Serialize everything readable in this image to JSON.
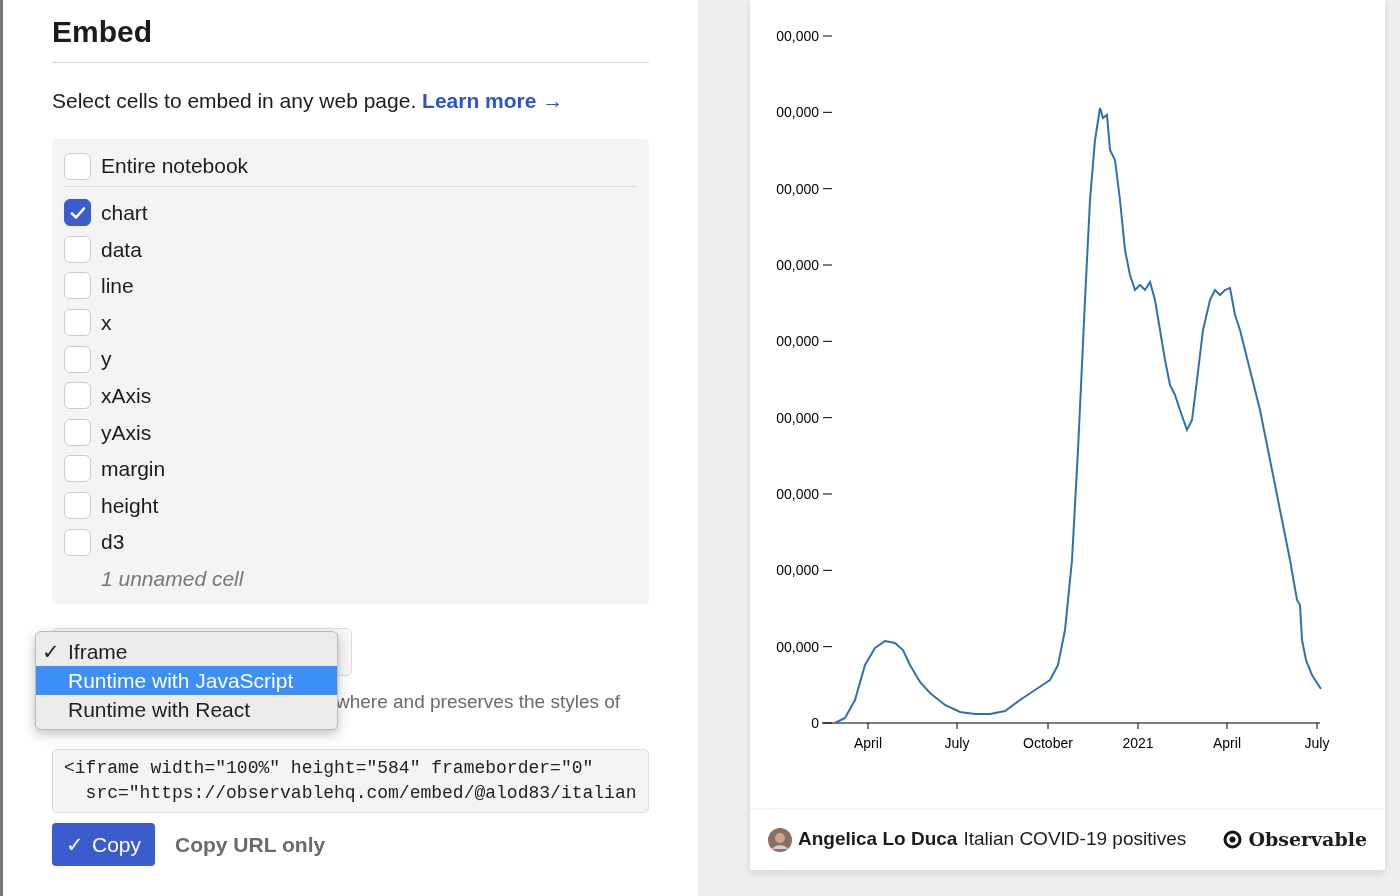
{
  "dialog": {
    "title": "Embed",
    "intro": "Select cells to embed in any web page.",
    "learn_more": "Learn more →",
    "cells": [
      {
        "label": "Entire notebook",
        "checked": false,
        "kind": "all"
      },
      {
        "label": "chart",
        "checked": true,
        "kind": "cell"
      },
      {
        "label": "data",
        "checked": false,
        "kind": "cell"
      },
      {
        "label": "line",
        "checked": false,
        "kind": "cell"
      },
      {
        "label": "x",
        "checked": false,
        "kind": "cell"
      },
      {
        "label": "y",
        "checked": false,
        "kind": "cell"
      },
      {
        "label": "xAxis",
        "checked": false,
        "kind": "cell"
      },
      {
        "label": "yAxis",
        "checked": false,
        "kind": "cell"
      },
      {
        "label": "margin",
        "checked": false,
        "kind": "cell"
      },
      {
        "label": "height",
        "checked": false,
        "kind": "cell"
      },
      {
        "label": "d3",
        "checked": false,
        "kind": "cell"
      }
    ],
    "unnamed_note": "1 unnamed cell",
    "format_menu": [
      {
        "label": "Iframe",
        "checked": true,
        "selected": false
      },
      {
        "label": "Runtime with JavaScript",
        "checked": false,
        "selected": true
      },
      {
        "label": "Runtime with React",
        "checked": false,
        "selected": false
      }
    ],
    "check_mark": "✓",
    "description_visible": "where and preserves the styles of",
    "code_lines": [
      "<iframe width=\"100%\" height=\"584\" frameborder=\"0\"",
      "  src=\"https://observablehq.com/embed/@alod83/italian"
    ],
    "copy_button": {
      "icon": "✓",
      "label": "Copy"
    },
    "copy_url": "Copy URL only"
  },
  "preview": {
    "y_tick_labels": [
      "00,000",
      "00,000",
      "00,000",
      "00,000",
      "00,000",
      "00,000",
      "00,000",
      "00,000",
      "00,000",
      "0"
    ],
    "x_tick_labels": [
      "April",
      "July",
      "October",
      "2021",
      "April",
      "July"
    ],
    "author": "Angelica Lo Duca",
    "notebook_title": "Italian COVID-19 positives",
    "brand": "Observable"
  }
}
